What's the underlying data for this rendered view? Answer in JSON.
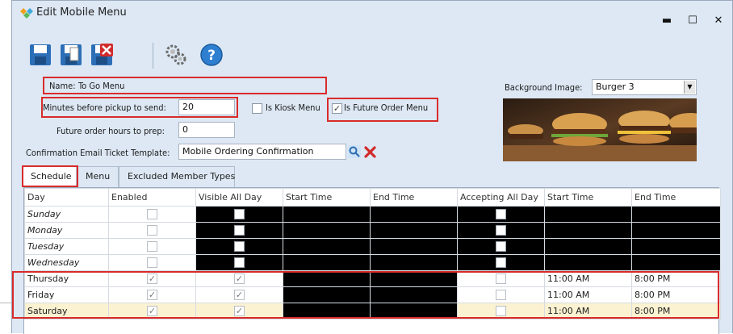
{
  "window": {
    "title": "Edit Mobile Menu",
    "minimize": "▬",
    "maximize": "☐",
    "close": "✕"
  },
  "toolbar": {
    "buttons": [
      {
        "name": "save-icon"
      },
      {
        "name": "save-new-icon"
      },
      {
        "name": "delete-icon"
      },
      {
        "name": "settings-icon"
      },
      {
        "name": "help-icon"
      }
    ]
  },
  "form": {
    "name_label": "Name:",
    "name_value": "To Go Menu",
    "minutes_label": "Minutes before pickup to send:",
    "minutes_value": "20",
    "kiosk_label": "Is Kiosk Menu",
    "kiosk_checked": false,
    "future_label": "Is Future Order Menu",
    "future_checked": true,
    "future_hours_label": "Future order hours to prep:",
    "future_hours_value": "0",
    "email_label": "Confirmation Email Ticket Template:",
    "email_value": "Mobile Ordering Confirmation",
    "bg_label": "Background Image:",
    "bg_value": "Burger 3"
  },
  "tabs": [
    "Schedule",
    "Menu",
    "Excluded Member Types"
  ],
  "grid": {
    "headers": [
      "Day",
      "Enabled",
      "Visible All Day",
      "Start Time",
      "End Time",
      "Accepting All Day",
      "Start Time",
      "End Time"
    ],
    "rows": [
      {
        "day": "Sunday",
        "enabled": false,
        "visible_all_day": false,
        "start": "",
        "end": "",
        "accepting_all_day": false,
        "a_start": "",
        "a_end": ""
      },
      {
        "day": "Monday",
        "enabled": false,
        "visible_all_day": false,
        "start": "",
        "end": "",
        "accepting_all_day": false,
        "a_start": "",
        "a_end": ""
      },
      {
        "day": "Tuesday",
        "enabled": false,
        "visible_all_day": false,
        "start": "",
        "end": "",
        "accepting_all_day": false,
        "a_start": "",
        "a_end": ""
      },
      {
        "day": "Wednesday",
        "enabled": false,
        "visible_all_day": false,
        "start": "",
        "end": "",
        "accepting_all_day": false,
        "a_start": "",
        "a_end": ""
      },
      {
        "day": "Thursday",
        "enabled": true,
        "visible_all_day": true,
        "start": "",
        "end": "",
        "accepting_all_day": false,
        "a_start": "11:00 AM",
        "a_end": "8:00 PM"
      },
      {
        "day": "Friday",
        "enabled": true,
        "visible_all_day": true,
        "start": "",
        "end": "",
        "accepting_all_day": false,
        "a_start": "11:00 AM",
        "a_end": "8:00 PM"
      },
      {
        "day": "Saturday",
        "enabled": true,
        "visible_all_day": true,
        "start": "",
        "end": "",
        "accepting_all_day": false,
        "a_start": "11:00 AM",
        "a_end": "8:00 PM"
      }
    ]
  },
  "colors": {
    "highlight": "#d92b2b",
    "window_bg": "#dde8f4",
    "selected_row": "#fbf2d2"
  }
}
